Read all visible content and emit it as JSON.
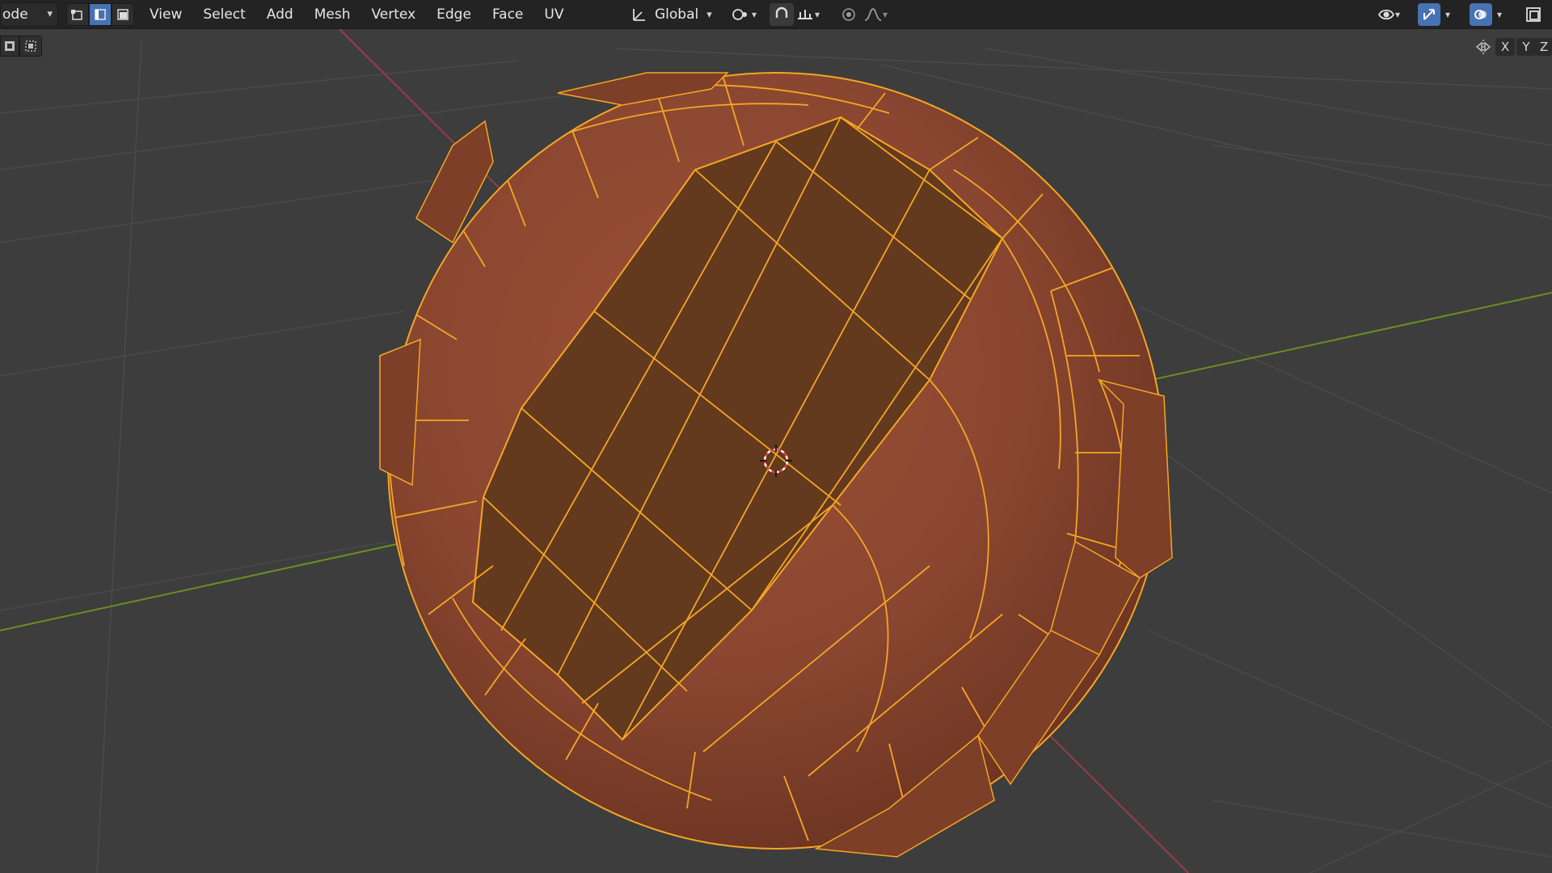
{
  "header": {
    "mode_label": "ode",
    "menus": [
      "View",
      "Select",
      "Add",
      "Mesh",
      "Vertex",
      "Edge",
      "Face",
      "UV"
    ],
    "orientation_label": "Global"
  },
  "axes_toggle": {
    "x": "X",
    "y": "Y",
    "z": "Z"
  },
  "colors": {
    "header_bg": "#232323",
    "viewport_bg": "#3d3d3d",
    "mesh_face": "#8e4a30",
    "selected_face": "#633a1e",
    "edge_select": "#f5a623",
    "active_blue": "#4772b3",
    "x_axis": "#9a3b4a",
    "y_axis": "#6b8e23"
  },
  "icons": {
    "select_modes": [
      "vertex-select-icon",
      "edge-select-icon",
      "face-select-icon"
    ],
    "toolbar": [
      "orientation-icon",
      "pivot-icon",
      "snap-icon",
      "snap-target-icon",
      "proportional-icon",
      "falloff-icon"
    ],
    "right": [
      "visibility-icon",
      "gizmo-icon",
      "overlay-icon",
      "xray-icon"
    ]
  }
}
